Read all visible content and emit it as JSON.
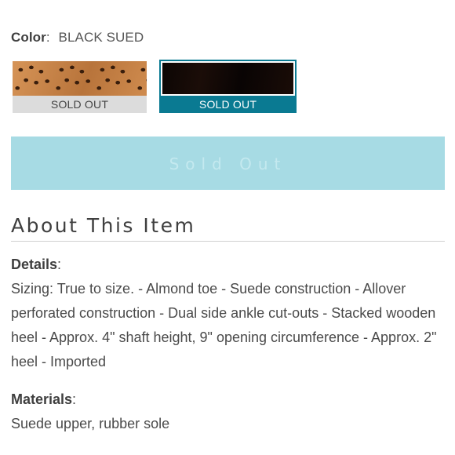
{
  "color": {
    "label": "Color",
    "value": "BLACK SUED"
  },
  "swatches": [
    {
      "name": "tan",
      "status": "SOLD OUT",
      "selected": false
    },
    {
      "name": "black",
      "status": "SOLD OUT",
      "selected": true
    }
  ],
  "buy_button": {
    "label": "Sold Out"
  },
  "about": {
    "title": "About This Item"
  },
  "details": {
    "heading": "Details",
    "text": "Sizing: True to size. - Almond toe - Suede construction - Allover perforated construction - Dual side ankle cut-outs - Stacked wooden heel - Approx. 4\" shaft height, 9\" opening circumference - Approx. 2\" heel - Imported"
  },
  "materials": {
    "heading": "Materials",
    "text": "Suede upper, rubber sole"
  },
  "colors": {
    "accent": "#0a7a92",
    "button_bg": "#a7dbe4",
    "sold_tag_bg": "#dcdcdc"
  }
}
